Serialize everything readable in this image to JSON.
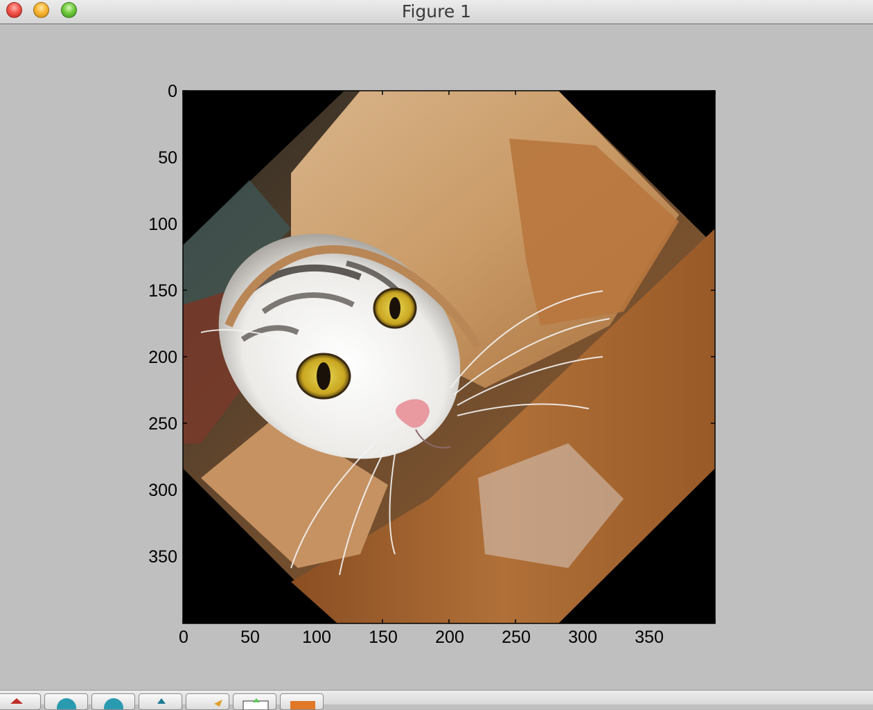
{
  "window": {
    "title": "Figure 1",
    "buttons": [
      "close",
      "minimize",
      "zoom"
    ]
  },
  "plot": {
    "content": "image of a cat peeking out of a rolled brown paper tube, rotated 45 degrees with black corners",
    "xticks": [
      "0",
      "50",
      "100",
      "150",
      "200",
      "250",
      "300",
      "350"
    ],
    "yticks": [
      "0",
      "50",
      "100",
      "150",
      "200",
      "250",
      "300",
      "350"
    ],
    "xlim": [
      0,
      400
    ],
    "ylim": [
      400,
      0
    ]
  },
  "toolbar": {
    "buttons": [
      "home-icon",
      "back-icon",
      "forward-icon",
      "pan-icon",
      "zoom-icon",
      "subplots-icon",
      "save-icon"
    ]
  }
}
